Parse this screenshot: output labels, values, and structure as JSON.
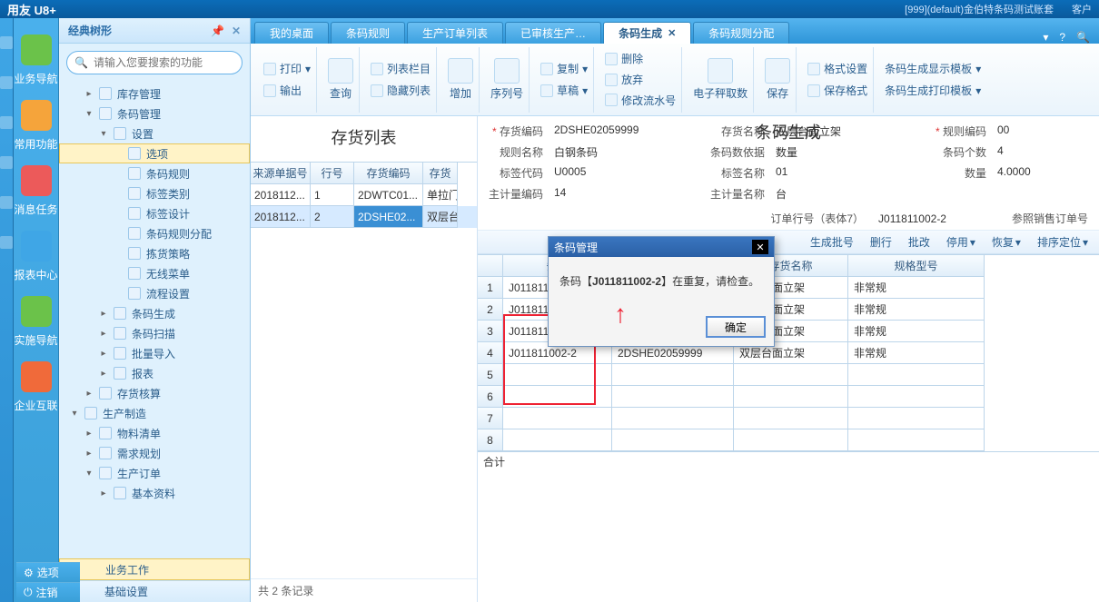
{
  "titlebar": {
    "brand": "用友 U8+",
    "account": "[999](default)金伯特条码测试账套",
    "right": "客户"
  },
  "bigside": {
    "items": [
      {
        "label": "业务导航",
        "color": "#6bc24a"
      },
      {
        "label": "常用功能",
        "color": "#f5a43b"
      },
      {
        "label": "消息任务",
        "color": "#ec5a5a"
      },
      {
        "label": "报表中心",
        "color": "#3fa6e6"
      },
      {
        "label": "实施导航",
        "color": "#6bc24a"
      },
      {
        "label": "企业互联",
        "color": "#f06a3a"
      }
    ],
    "foot": {
      "options": "选项",
      "logout": "注销"
    }
  },
  "treepanel": {
    "title": "经典树形",
    "search_placeholder": "请输入您要搜索的功能",
    "foot": {
      "biz": "业务工作",
      "base": "基础设置"
    }
  },
  "tree": [
    {
      "d": 1,
      "t": "closed",
      "label": "库存管理"
    },
    {
      "d": 1,
      "t": "open",
      "label": "条码管理"
    },
    {
      "d": 2,
      "t": "open",
      "label": "设置"
    },
    {
      "d": 3,
      "t": "leaf",
      "label": "选项",
      "sel": true
    },
    {
      "d": 3,
      "t": "leaf",
      "label": "条码规则"
    },
    {
      "d": 3,
      "t": "leaf",
      "label": "标签类别"
    },
    {
      "d": 3,
      "t": "leaf",
      "label": "标签设计"
    },
    {
      "d": 3,
      "t": "leaf",
      "label": "条码规则分配"
    },
    {
      "d": 3,
      "t": "leaf",
      "label": "拣货策略"
    },
    {
      "d": 3,
      "t": "leaf",
      "label": "无线菜单"
    },
    {
      "d": 3,
      "t": "leaf",
      "label": "流程设置"
    },
    {
      "d": 2,
      "t": "closed",
      "label": "条码生成"
    },
    {
      "d": 2,
      "t": "closed",
      "label": "条码扫描"
    },
    {
      "d": 2,
      "t": "closed",
      "label": "批量导入"
    },
    {
      "d": 2,
      "t": "closed",
      "label": "报表"
    },
    {
      "d": 1,
      "t": "closed",
      "label": "存货核算"
    },
    {
      "d": 0,
      "t": "open",
      "label": "生产制造"
    },
    {
      "d": 1,
      "t": "closed",
      "label": "物料清单"
    },
    {
      "d": 1,
      "t": "closed",
      "label": "需求规划"
    },
    {
      "d": 1,
      "t": "open",
      "label": "生产订单"
    },
    {
      "d": 2,
      "t": "closed",
      "label": "基本资料"
    }
  ],
  "tabs": {
    "items": [
      {
        "label": "我的桌面"
      },
      {
        "label": "条码规则"
      },
      {
        "label": "生产订单列表"
      },
      {
        "label": "已审核生产…"
      },
      {
        "label": "条码生成",
        "active": true,
        "closable": true
      },
      {
        "label": "条码规则分配"
      }
    ]
  },
  "ribbon": {
    "print": "打印",
    "export": "输出",
    "query": "查询",
    "cols": "列表栏目",
    "hidecols": "隐藏列表",
    "add": "增加",
    "serial": "序列号",
    "copy": "复制",
    "draft": "草稿",
    "delete": "删除",
    "abandon": "放弃",
    "editflow": "修改流水号",
    "eprint": "电子秤取数",
    "save": "保存",
    "format": "格式设置",
    "savefmt": "保存格式",
    "disptpl": "条码生成显示模板",
    "printtpl": "条码生成打印模板"
  },
  "leftpane": {
    "title": "存货列表",
    "headers": [
      "来源单据号",
      "行号",
      "存货编码",
      "存货"
    ],
    "rows": [
      [
        "2018112...",
        "1",
        "2DWTC01...",
        "单拉门"
      ],
      [
        "2018112...",
        "2",
        "2DSHE02...",
        "双层台"
      ]
    ],
    "foot": "共 2 条记录"
  },
  "rightpane": {
    "title": "条码生成",
    "form": {
      "invcode_l": "存货编码",
      "invcode": "2DSHE02059999",
      "invname_l": "存货名称",
      "invname": "双层台面立架",
      "rulecode_l": "规则编码",
      "rulecode": "00",
      "rulename_l": "规则名称",
      "rulename": "白钢条码",
      "barbase_l": "条码数依据",
      "barbase": "数量",
      "barcount_l": "条码个数",
      "barcount": "4",
      "tagcode_l": "标签代码",
      "tagcode": "U0005",
      "tagname_l": "标签名称",
      "tagname": "01",
      "qty_l": "数量",
      "qty": "4.0000",
      "unit_l": "主计量编码",
      "unitval": "14",
      "unitname_l": "主计量名称",
      "unitname": "台"
    },
    "row2": {
      "orderline_l": "订单行号（表体7）",
      "orderline": "J011811002-2",
      "refso_l": "参照销售订单号"
    },
    "toolbar2": {
      "genbatch": "生成批号",
      "delrow": "删行",
      "batch": "批改",
      "disable": "停用",
      "restore": "恢复",
      "locate": "排序定位"
    },
    "grid": {
      "headers": [
        "条码",
        "存货编码",
        "存货名称",
        "规格型号"
      ],
      "rows": [
        [
          "J011811002-2",
          "2DSHE02059999",
          "双层台面立架",
          "非常规"
        ],
        [
          "J011811002-2",
          "2DSHE02059999",
          "双层台面立架",
          "非常规"
        ],
        [
          "J011811002-2",
          "2DSHE02059999",
          "双层台面立架",
          "非常规"
        ],
        [
          "J011811002-2",
          "2DSHE02059999",
          "双层台面立架",
          "非常规"
        ]
      ],
      "emptyrows": 4,
      "sum": "合计"
    }
  },
  "dialog": {
    "title": "条码管理",
    "msg_pre": "条码【",
    "msg_code": "J011811002-2",
    "msg_post": "】在重复，请检查。",
    "ok": "确定"
  }
}
